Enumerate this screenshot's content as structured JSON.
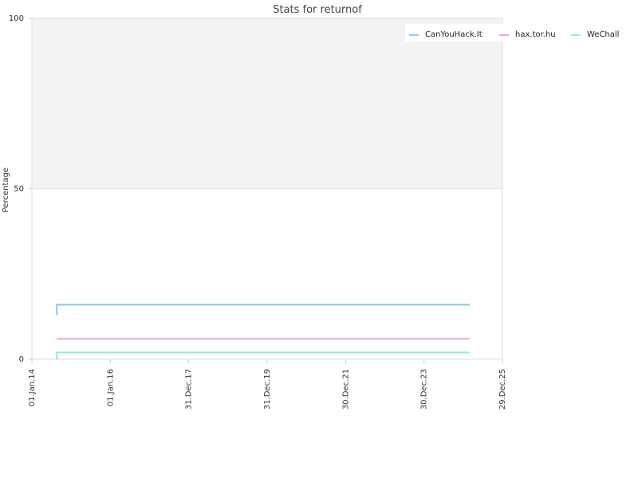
{
  "chart_data": {
    "type": "line",
    "title": "Stats for returnof",
    "xlabel": "",
    "ylabel": "Percentage",
    "ylim": [
      0,
      100
    ],
    "y_ticks": [
      "0",
      "50",
      "100"
    ],
    "y_tick_values": [
      0,
      50,
      100
    ],
    "x_range": [
      "2014-01-01",
      "2025-12-29"
    ],
    "x_ticks": [
      "01.Jan.14",
      "01.Jan.16",
      "31.Dec.17",
      "31.Dec.19",
      "30.Dec.21",
      "30.Dec.23",
      "29.Dec.25"
    ],
    "x_tick_dates": [
      "2014-01-01",
      "2016-01-01",
      "2017-12-31",
      "2019-12-31",
      "2021-12-30",
      "2023-12-30",
      "2025-12-29"
    ],
    "shaded_band": [
      50,
      100
    ],
    "legend_position": "top-right",
    "series": [
      {
        "name": "CanYouHack.It",
        "color": "#8ecae6",
        "points": [
          {
            "x": "2014-08-20",
            "y": 13
          },
          {
            "x": "2014-08-21",
            "y": 16
          },
          {
            "x": "2025-03-01",
            "y": 16
          }
        ]
      },
      {
        "name": "hax.tor.hu",
        "color": "#f4a6c8",
        "points": [
          {
            "x": "2014-08-20",
            "y": 6
          },
          {
            "x": "2025-03-01",
            "y": 6
          }
        ]
      },
      {
        "name": "WeChall",
        "color": "#96ead7",
        "points": [
          {
            "x": "2014-08-20",
            "y": 0
          },
          {
            "x": "2014-08-21",
            "y": 2
          },
          {
            "x": "2025-03-01",
            "y": 2
          }
        ]
      }
    ]
  }
}
